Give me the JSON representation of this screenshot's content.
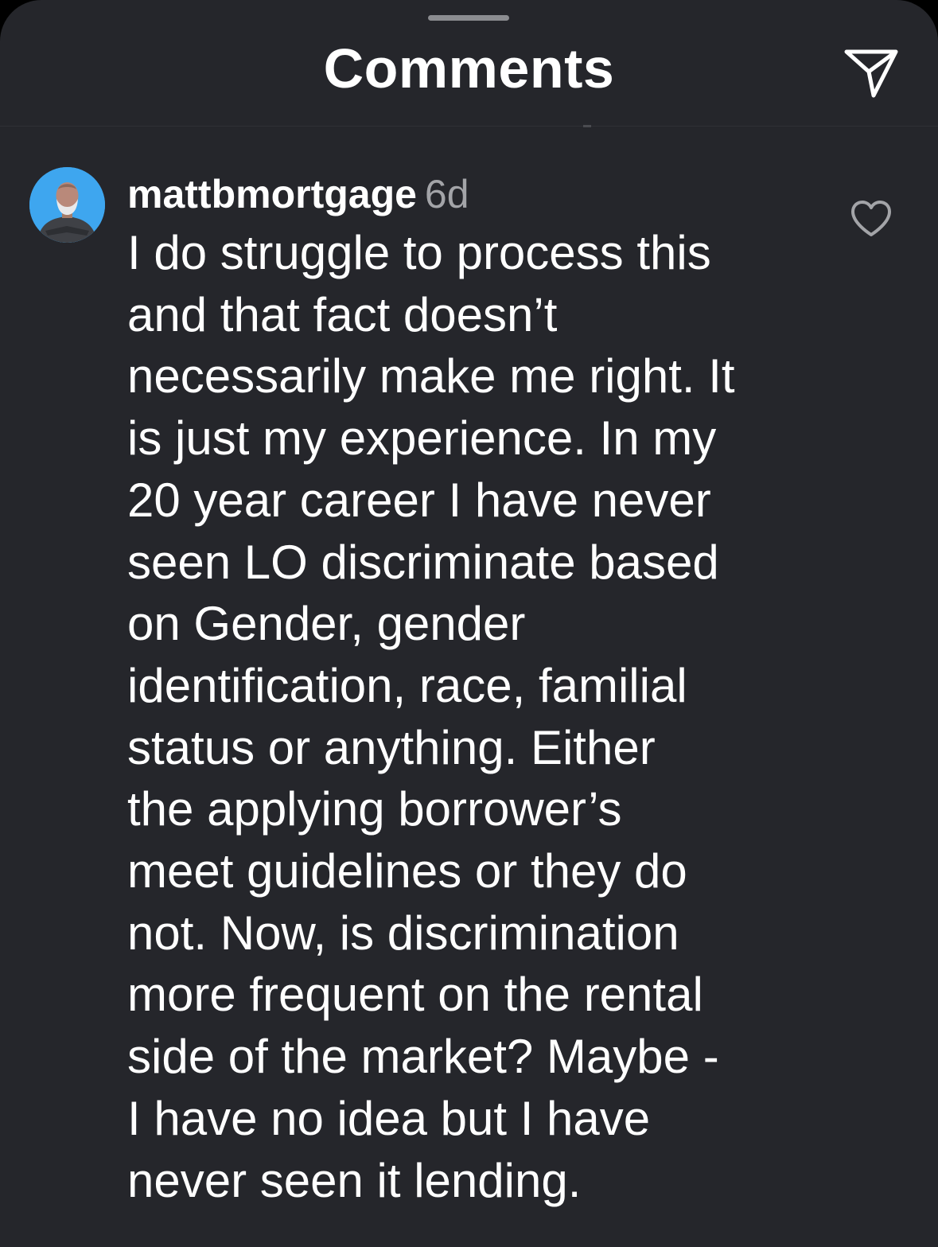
{
  "header": {
    "title": "Comments",
    "share_icon": "paper-plane-icon"
  },
  "colors": {
    "sheet_background": "#25262b",
    "avatar_background": "#3ea6ef",
    "timestamp": "#a3a4a8"
  },
  "comment": {
    "username": "mattbmortgage",
    "timestamp": "6d",
    "text": "I do struggle to process this\nand that fact doesn’t\nnecessarily make me right. It\nis just my experience. In my\n20 year career I have never\nseen LO discriminate based\non Gender, gender\nidentification, race, familial\nstatus or anything. Either\nthe applying borrower’s\nmeet guidelines or they do\nnot. Now, is discrimination\nmore frequent on the rental\nside of the market? Maybe -\nI have no idea but I have\nnever seen it lending.",
    "avatar_icon": "profile-photo",
    "like_icon": "heart-outline-icon"
  }
}
